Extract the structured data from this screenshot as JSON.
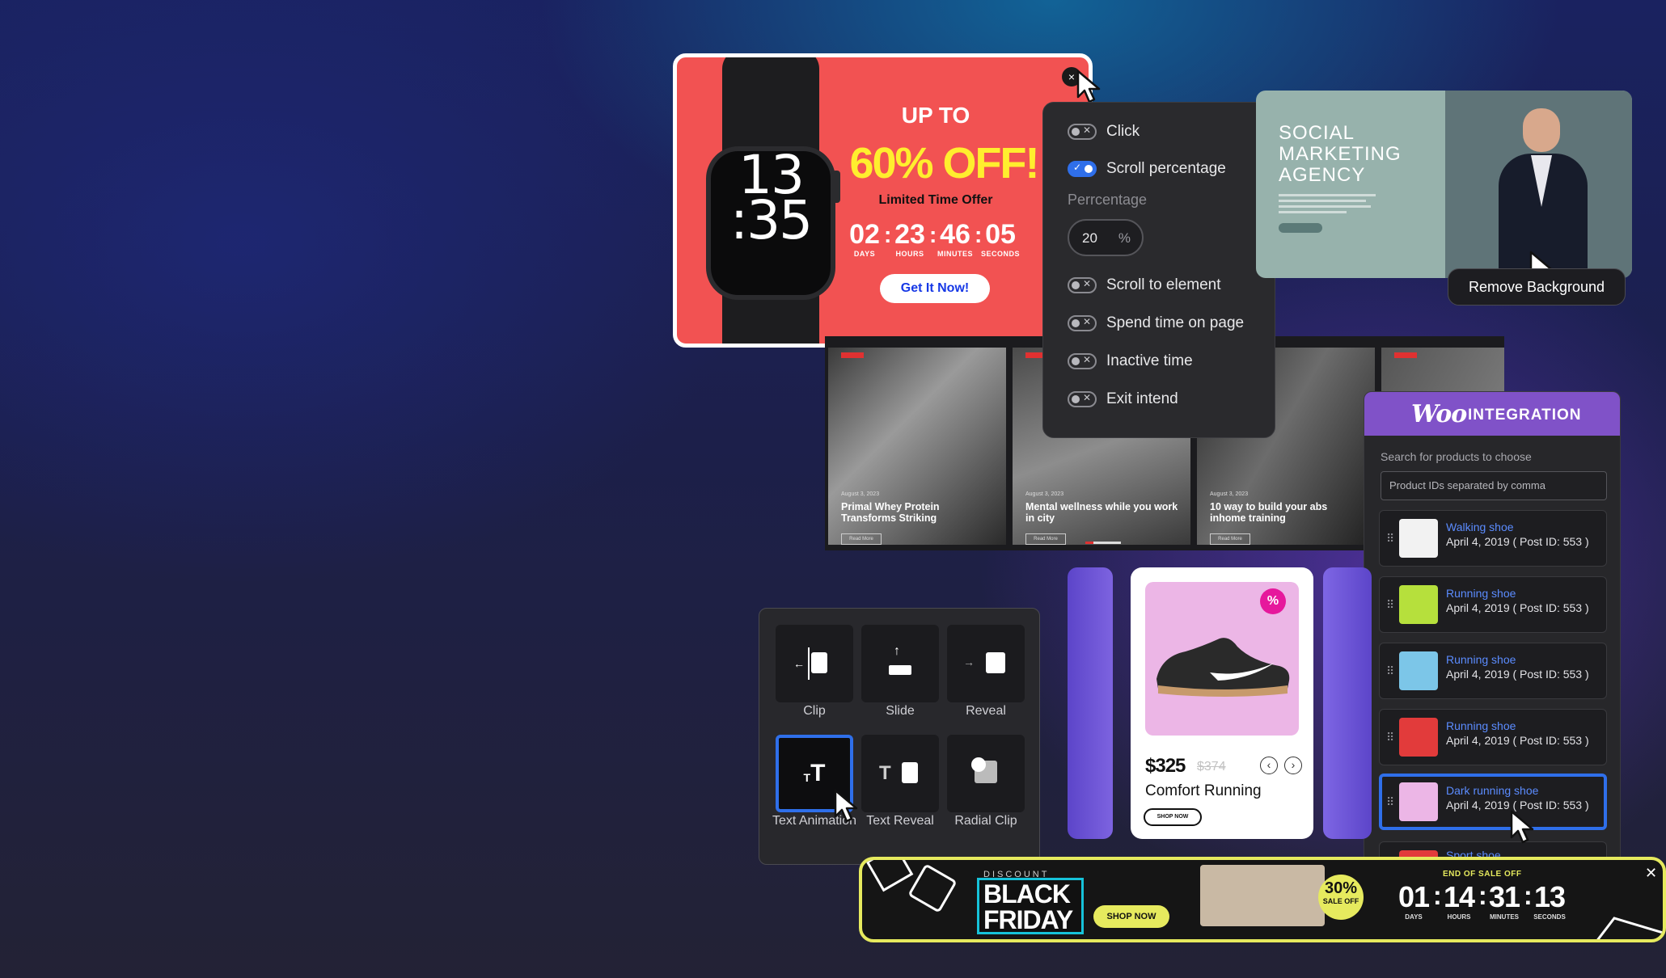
{
  "popup": {
    "watch_time": "13\n:35",
    "up_to": "UP TO",
    "discount": "60% OFF!",
    "limited": "Limited Time Offer",
    "countdown": [
      {
        "value": "02",
        "label": "DAYS"
      },
      {
        "value": "23",
        "label": "HOURS"
      },
      {
        "value": "46",
        "label": "MINUTES"
      },
      {
        "value": "05",
        "label": "SECONDS"
      }
    ],
    "cta": "Get It Now!",
    "close": "×"
  },
  "triggers": {
    "items": [
      {
        "label": "Click",
        "on": false
      },
      {
        "label": "Scroll percentage",
        "on": true
      },
      {
        "label": "Scroll to element",
        "on": false
      },
      {
        "label": "Spend time on page",
        "on": false
      },
      {
        "label": "Inactive time",
        "on": false
      },
      {
        "label": "Exit intend",
        "on": false
      }
    ],
    "percentage_label": "Perrcentage",
    "percentage_value": "20",
    "percentage_unit": "%"
  },
  "social": {
    "title": "SOCIAL MARKETING AGENCY",
    "remove_bg": "Remove Background"
  },
  "blog": {
    "posts": [
      {
        "title": "Primal Whey Protein Transforms Striking",
        "date": "August 3, 2023",
        "more": "Read More"
      },
      {
        "title": "Mental wellness while you work in city",
        "date": "August 3, 2023",
        "more": "Read More"
      },
      {
        "title": "10 way to build your abs inhome training",
        "date": "August 3, 2023",
        "more": "Read More"
      }
    ]
  },
  "woo": {
    "logo": "Woo",
    "title": "INTEGRATION",
    "search_label": "Search for products to choose",
    "input_placeholder": "Product IDs separated by comma",
    "products": [
      {
        "name": "Walking shoe",
        "meta": "April 4, 2019 ( Post ID: 553 )",
        "color": "#f2f2f2",
        "selected": false
      },
      {
        "name": "Running shoe",
        "meta": "April 4, 2019 ( Post ID: 553 )",
        "color": "#b6e03c",
        "selected": false
      },
      {
        "name": "Running shoe",
        "meta": "April 4, 2019 ( Post ID: 553 )",
        "color": "#7cc6e8",
        "selected": false
      },
      {
        "name": "Running shoe",
        "meta": "April 4, 2019 ( Post ID: 553 )",
        "color": "#e23b3b",
        "selected": false
      },
      {
        "name": "Dark running shoe",
        "meta": "April 4, 2019 ( Post ID: 553 )",
        "color": "#ecb6e6",
        "selected": true
      },
      {
        "name": "Sport shoe",
        "meta": "",
        "color": "#e23b3b",
        "selected": false
      }
    ]
  },
  "product": {
    "badge": "%",
    "price": "$325",
    "old_price": "$374",
    "name": "Comfort Running",
    "shop": "SHOP NOW",
    "prev": "‹",
    "next": "›"
  },
  "animations": {
    "items": [
      {
        "label": "Clip"
      },
      {
        "label": "Slide"
      },
      {
        "label": "Reveal"
      },
      {
        "label": "Text Animation",
        "selected": true
      },
      {
        "label": "Text Reveal"
      },
      {
        "label": "Radial Clip"
      }
    ]
  },
  "black_friday": {
    "discount": "DISCOUNT",
    "black": "BLACK",
    "friday": "FRIDAY",
    "shop": "SHOP NOW",
    "sale_percent": "30%",
    "sale_text": "SALE OFF",
    "end_label": "END OF SALE OFF",
    "countdown": [
      {
        "value": "01",
        "label": "DAYS"
      },
      {
        "value": "14",
        "label": "HOURS"
      },
      {
        "value": "31",
        "label": "MINUTES"
      },
      {
        "value": "13",
        "label": "SECONDS"
      }
    ],
    "close": "✕"
  }
}
